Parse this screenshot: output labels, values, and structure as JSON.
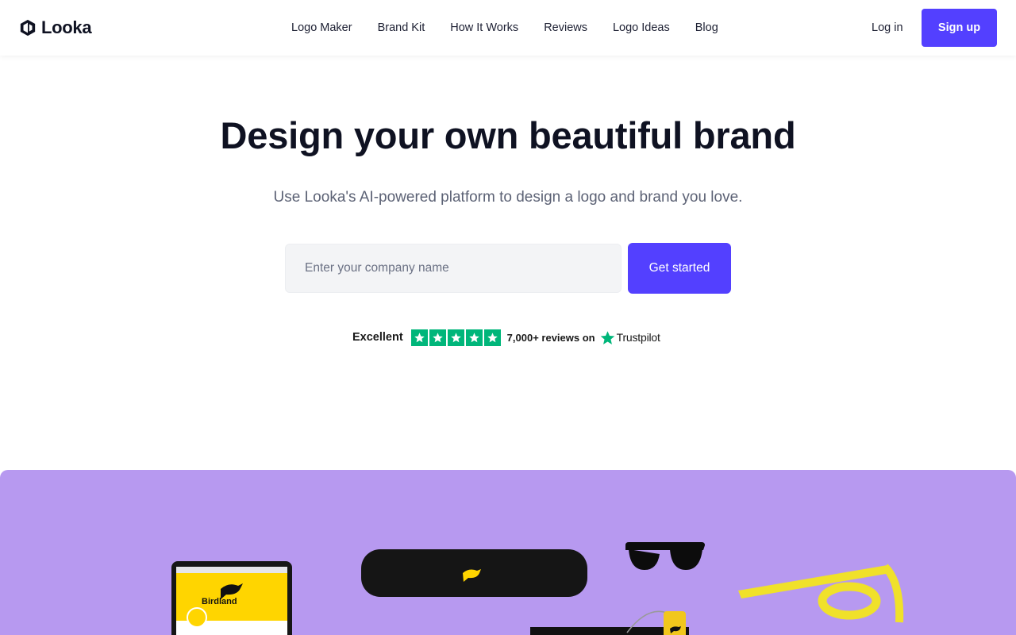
{
  "brand": {
    "name": "Looka",
    "icon": "looka-logo-icon"
  },
  "nav": {
    "items": [
      {
        "label": "Logo Maker"
      },
      {
        "label": "Brand Kit"
      },
      {
        "label": "How It Works"
      },
      {
        "label": "Reviews"
      },
      {
        "label": "Logo Ideas"
      },
      {
        "label": "Blog"
      }
    ],
    "login_label": "Log in",
    "signup_label": "Sign up"
  },
  "hero": {
    "title": "Design your own beautiful brand",
    "subtitle": "Use Looka's AI-powered platform to design a logo and brand you love.",
    "input_placeholder": "Enter your company name",
    "cta_label": "Get started"
  },
  "trustpilot": {
    "rating_label": "Excellent",
    "stars": 5,
    "reviews_text": "7,000+ reviews on",
    "brand_name": "Trustpilot"
  },
  "showcase": {
    "mockup_brand_name": "Birdland"
  },
  "colors": {
    "accent": "#5340ff",
    "trustpilot_green": "#00b67a",
    "showcase_bg": "#b799f0",
    "mockup_yellow": "#ffd500"
  }
}
